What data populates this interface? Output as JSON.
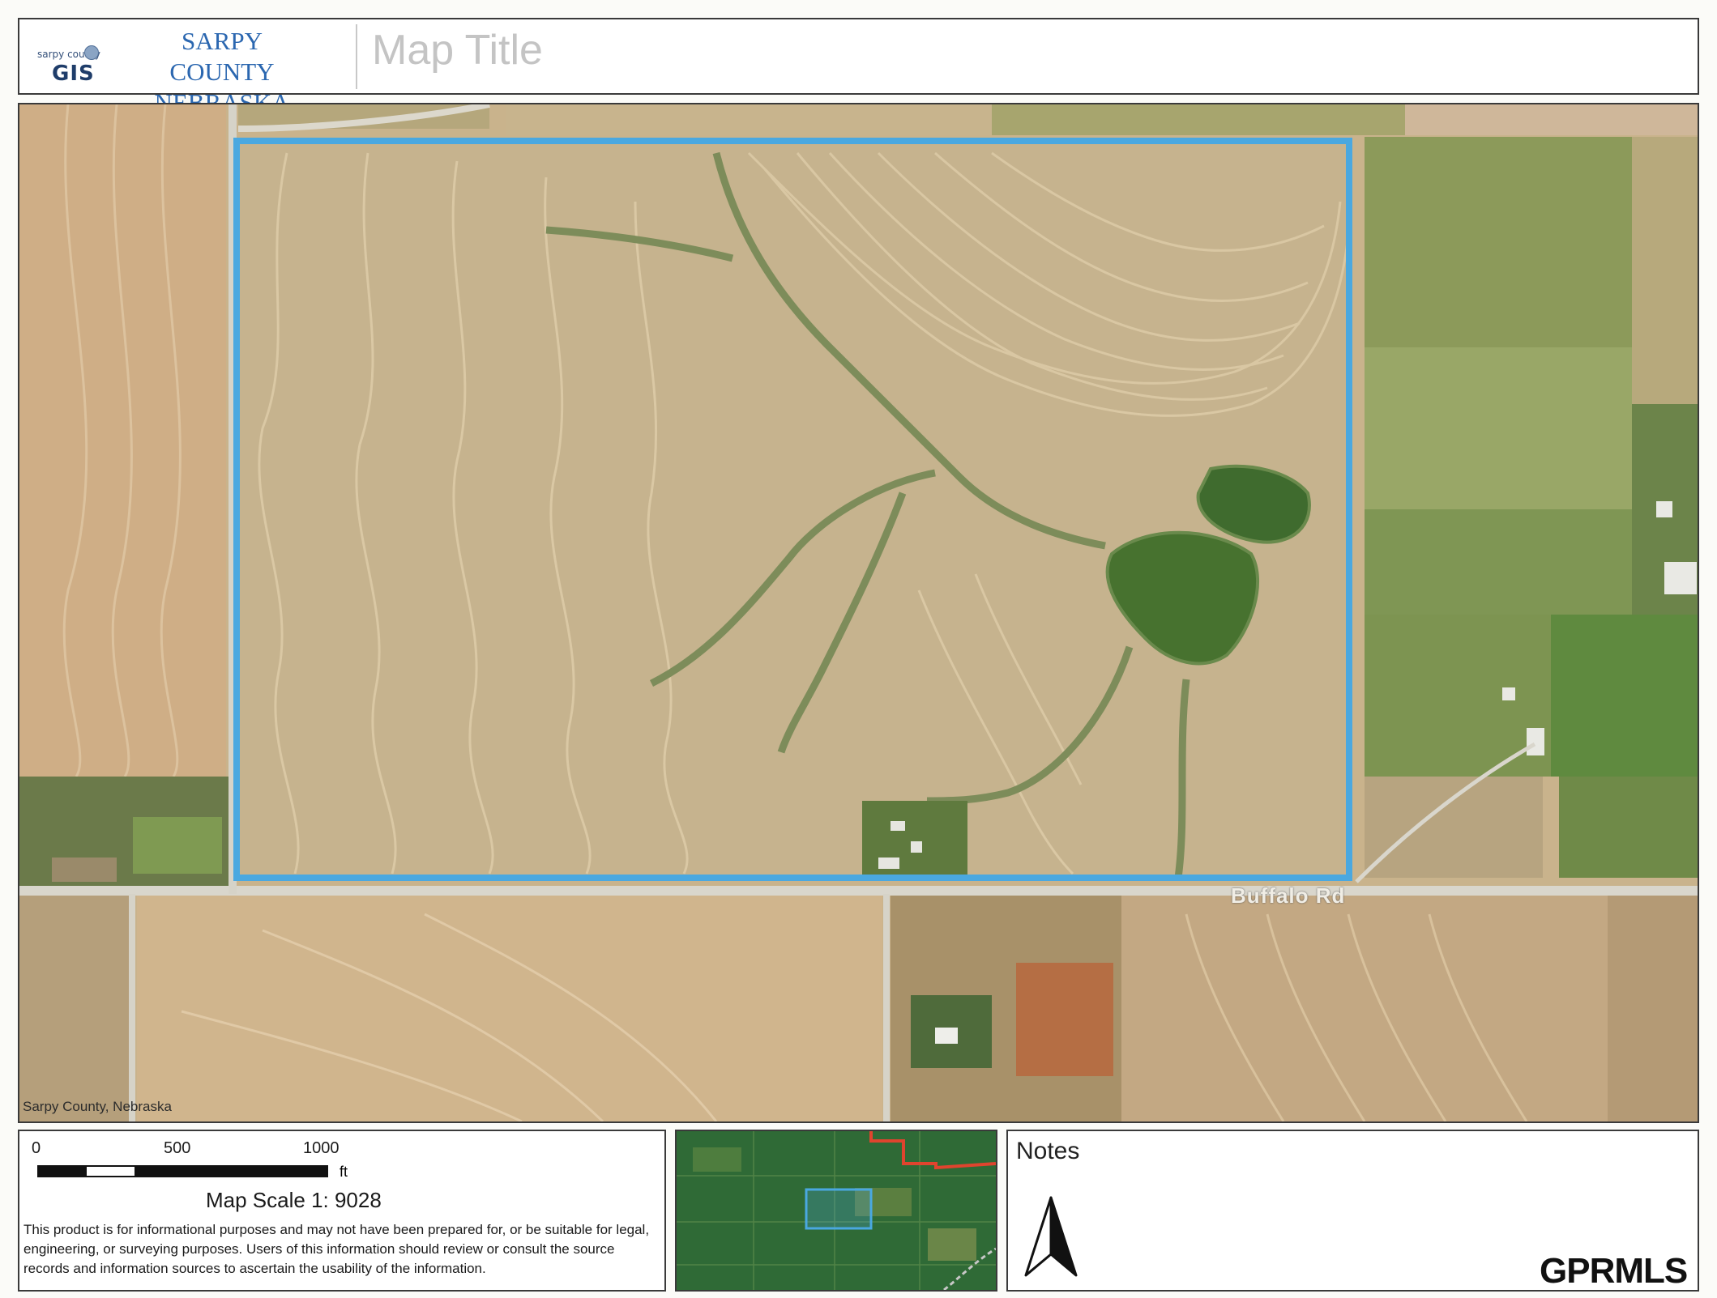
{
  "header": {
    "logo_small_text": "sarpy county",
    "logo_gis_text": "GIS",
    "county_line1": "SARPY COUNTY",
    "county_line2": "NEBRASKA",
    "map_title": "Map Title"
  },
  "map": {
    "credit": "Sarpy County, Nebraska",
    "road_label": "Buffalo Rd",
    "parcel_outline_color": "#4aa8e0"
  },
  "scale": {
    "ticks": [
      "0",
      "500",
      "1000"
    ],
    "unit": "ft",
    "scale_text": "Map Scale 1: 9028",
    "disclaimer": "This product is for informational purposes and may not have been prepared for, or be suitable for legal, engineering, or surveying purposes. Users of this information should review or consult the source records and information sources to ascertain the usability of the information."
  },
  "overview": {
    "boundary_color": "#e0442e",
    "parcel_color": "#4aa8e0"
  },
  "notes": {
    "title": "Notes",
    "north_arrow_icon": "north-arrow-icon"
  },
  "watermark": "GPRMLS"
}
